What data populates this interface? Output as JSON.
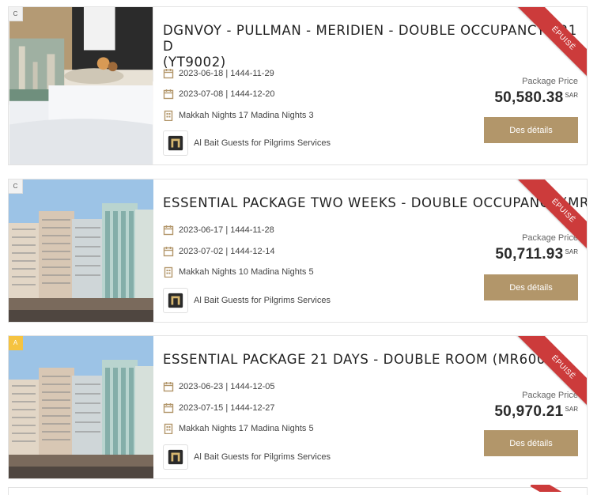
{
  "colors": {
    "accent": "#b2966a",
    "ribbon": "#cc3b3b",
    "badge_a": "#f5c341"
  },
  "packages": [
    {
      "category": "C",
      "title": "DGNVOY - PULLMAN - MERIDIEN - DOUBLE OCCUPANCY - 21 D",
      "title_line2": "(YT9002)",
      "ribbon": "ÉPUISÉ",
      "departure": "2023-06-18 | 1444-11-29",
      "return": "2023-07-08 | 1444-12-20",
      "nights": "Makkah Nights 17 Madina Nights 3",
      "agency": "Al Bait Guests for Pilgrims Services",
      "price_label": "Package Price",
      "price": "50,580.38",
      "currency": "SAR",
      "button": "Des détails",
      "image": "hotel-room-service-photo"
    },
    {
      "category": "C",
      "title": "ESSENTIAL PACKAGE TWO WEEKS - DOUBLE OCCUPANCY (MR",
      "ribbon": "ÉPUISÉ",
      "departure": "2023-06-17 | 1444-11-28",
      "return": "2023-07-02 | 1444-12-14",
      "nights": "Makkah Nights 10 Madina Nights 5",
      "agency": "Al Bait Guests for Pilgrims Services",
      "price_label": "Package Price",
      "price": "50,711.93",
      "currency": "SAR",
      "button": "Des détails",
      "image": "hotel-towers-photo"
    },
    {
      "category": "A",
      "title": "ESSENTIAL PACKAGE 21 DAYS - DOUBLE ROOM (MR6000)",
      "ribbon": "ÉPUISÉ",
      "departure": "2023-06-23 | 1444-12-05",
      "return": "2023-07-15 | 1444-12-27",
      "nights": "Makkah Nights 17 Madina Nights 5",
      "agency": "Al Bait Guests for Pilgrims Services",
      "price_label": "Package Price",
      "price": "50,970.21",
      "currency": "SAR",
      "button": "Des détails",
      "image": "hotel-towers-photo"
    }
  ]
}
